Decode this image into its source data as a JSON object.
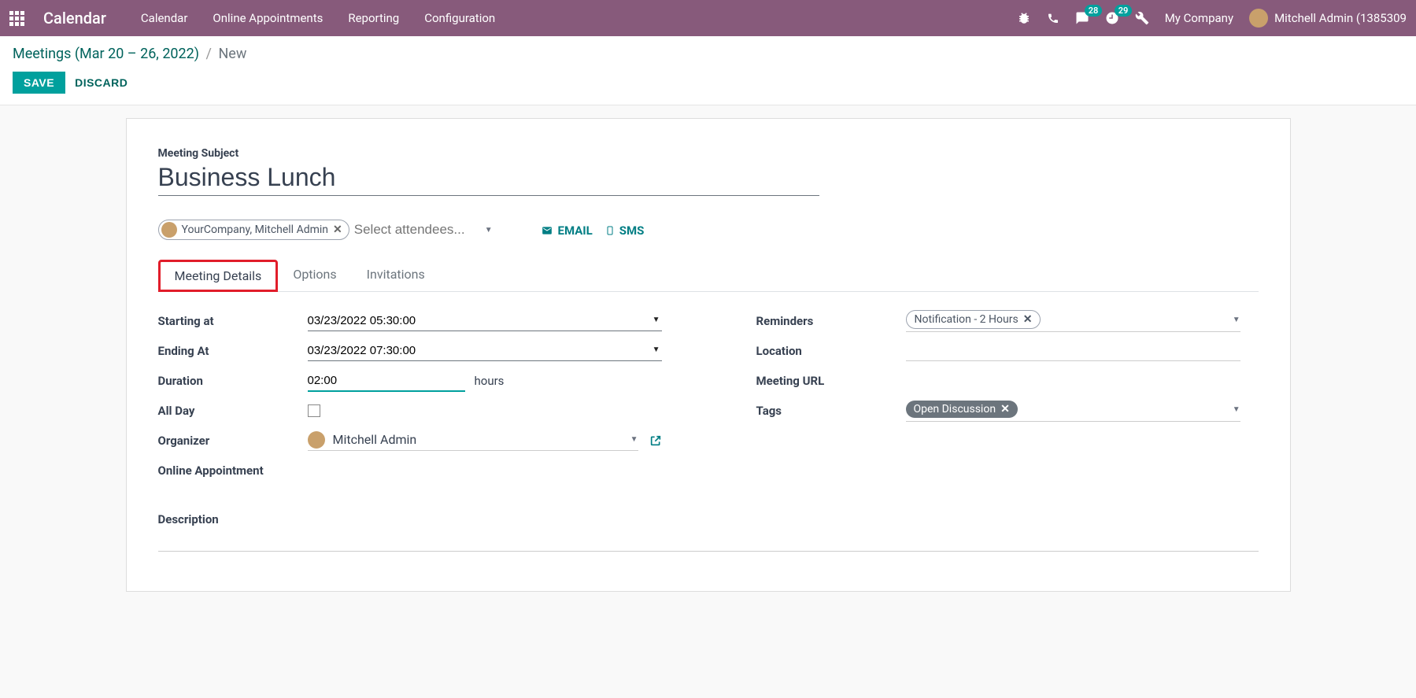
{
  "navbar": {
    "app_title": "Calendar",
    "menu": [
      "Calendar",
      "Online Appointments",
      "Reporting",
      "Configuration"
    ],
    "msg_badge": "28",
    "act_badge": "29",
    "company": "My Company",
    "user": "Mitchell Admin (1385309"
  },
  "breadcrumb": {
    "parent": "Meetings (Mar 20 – 26, 2022)",
    "sep": "/",
    "current": "New"
  },
  "actions": {
    "save": "SAVE",
    "discard": "DISCARD"
  },
  "form": {
    "subject_label": "Meeting Subject",
    "subject_value": "Business Lunch",
    "attendee_pill": "YourCompany, Mitchell Admin",
    "attendee_placeholder": "Select attendees...",
    "email_btn": "EMAIL",
    "sms_btn": "SMS",
    "tabs": {
      "t1": "Meeting Details",
      "t2": "Options",
      "t3": "Invitations"
    },
    "labels": {
      "start": "Starting at",
      "end": "Ending At",
      "duration": "Duration",
      "allday": "All Day",
      "organizer": "Organizer",
      "online_appt": "Online Appointment",
      "reminders": "Reminders",
      "location": "Location",
      "meeting_url": "Meeting URL",
      "tags": "Tags",
      "description": "Description"
    },
    "values": {
      "start": "03/23/2022 05:30:00",
      "end": "03/23/2022 07:30:00",
      "duration": "02:00",
      "hours_unit": "hours",
      "organizer": "Mitchell Admin",
      "reminder_tag": "Notification - 2 Hours",
      "open_tag": "Open Discussion"
    }
  }
}
